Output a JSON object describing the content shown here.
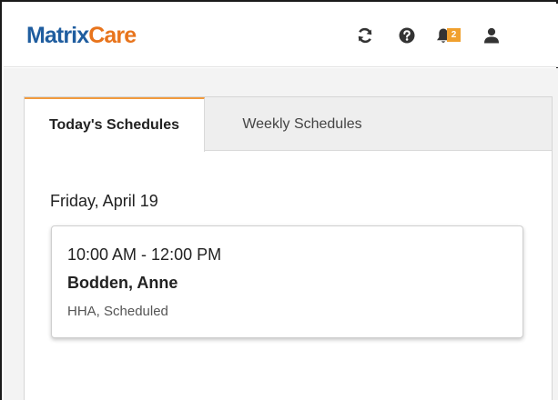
{
  "header": {
    "brand_part1": "Matrix",
    "brand_part2": "Care",
    "notification_count": "2",
    "icons": [
      "refresh-icon",
      "help-icon",
      "bell-icon",
      "user-icon"
    ]
  },
  "tabs": [
    {
      "label": "Today's Schedules",
      "active": true
    },
    {
      "label": "Weekly Schedules",
      "active": false
    }
  ],
  "schedule": {
    "date": "Friday, April 19",
    "items": [
      {
        "time": "10:00 AM - 12:00 PM",
        "client": "Bodden, Anne",
        "status": "HHA, Scheduled"
      }
    ]
  },
  "colors": {
    "brand_blue": "#1f5d9f",
    "brand_orange": "#e8741c",
    "badge": "#f0a02e",
    "active_tab_accent": "#f19a3e"
  }
}
